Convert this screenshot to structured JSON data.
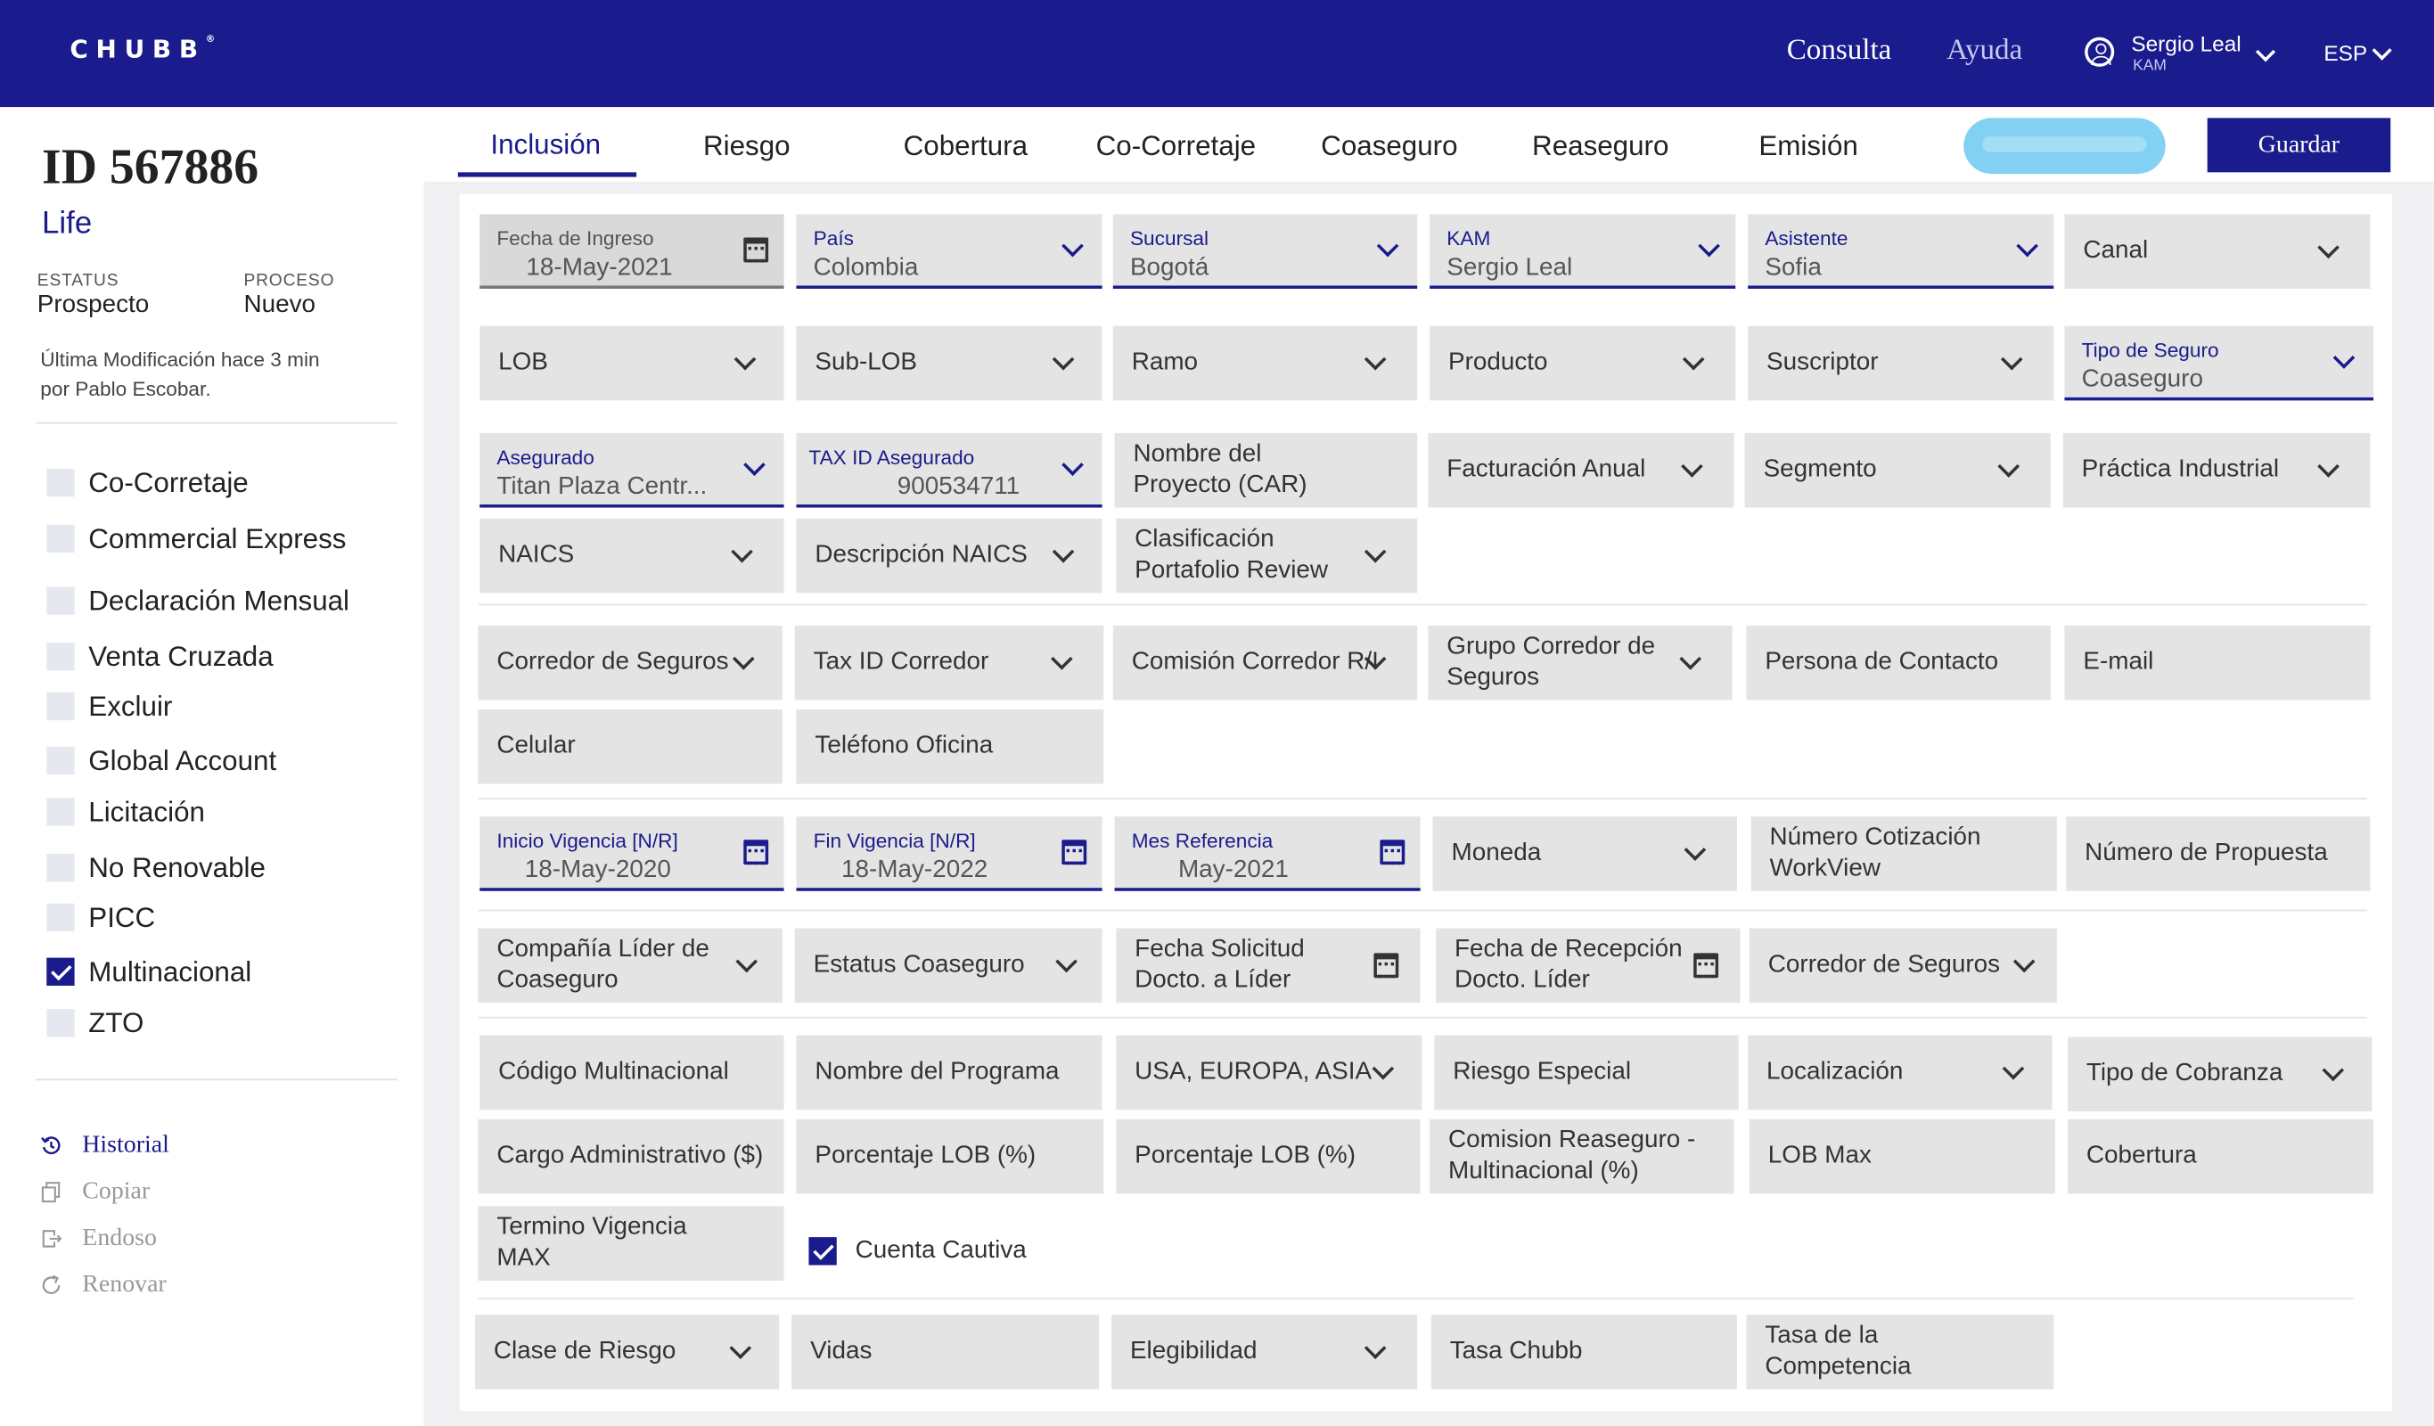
{
  "header": {
    "logo": "CHUBB",
    "nav": [
      "Consulta",
      "Ayuda"
    ],
    "user": {
      "name": "Sergio Leal",
      "role": "KAM"
    },
    "language": "ESP"
  },
  "sidebar": {
    "id": "ID 567886",
    "product": "Life",
    "status_label": "ESTATUS",
    "status": "Prospecto",
    "process_label": "PROCESO",
    "process": "Nuevo",
    "last_modified_line1": "Última Modificación hace 3 min",
    "last_modified_line2": "por Pablo Escobar.",
    "checkboxes": [
      {
        "label": "Co-Corretaje",
        "checked": false
      },
      {
        "label": "Commercial Express",
        "checked": false
      },
      {
        "label": "Declaración Mensual",
        "checked": false
      },
      {
        "label": "Venta Cruzada",
        "checked": false
      },
      {
        "label": "Excluir",
        "checked": false
      },
      {
        "label": "Global Account",
        "checked": false
      },
      {
        "label": "Licitación",
        "checked": false
      },
      {
        "label": "No Renovable",
        "checked": false
      },
      {
        "label": "PICC",
        "checked": false
      },
      {
        "label": "Multinacional",
        "checked": true
      },
      {
        "label": "ZTO",
        "checked": false
      }
    ],
    "actions": [
      {
        "label": "Historial",
        "icon": "history-icon",
        "active": true
      },
      {
        "label": "Copiar",
        "icon": "copy-icon",
        "active": false
      },
      {
        "label": "Endoso",
        "icon": "endorse-icon",
        "active": false
      },
      {
        "label": "Renovar",
        "icon": "renew-icon",
        "active": false
      }
    ]
  },
  "tabs": [
    "Inclusión",
    "Riesgo",
    "Cobertura",
    "Co-Corretaje",
    "Coaseguro",
    "Reaseguro",
    "Emisión"
  ],
  "active_tab": "Inclusión",
  "save_label": "Guardar",
  "form": {
    "fecha_ingreso": {
      "label": "Fecha de Ingreso",
      "value": "18-May-2021"
    },
    "pais": {
      "label": "País",
      "value": "Colombia"
    },
    "sucursal": {
      "label": "Sucursal",
      "value": "Bogotá"
    },
    "kam": {
      "label": "KAM",
      "value": "Sergio Leal"
    },
    "asistente": {
      "label": "Asistente",
      "value": "Sofia"
    },
    "canal": "Canal",
    "lob": "LOB",
    "sub_lob": "Sub-LOB",
    "ramo": "Ramo",
    "producto": "Producto",
    "suscriptor": "Suscriptor",
    "tipo_seguro": {
      "label": "Tipo de Seguro",
      "value": "Coaseguro"
    },
    "asegurado": {
      "label": "Asegurado",
      "value": "Titan Plaza Centr..."
    },
    "tax_id_asegurado": {
      "label": "TAX ID Asegurado",
      "value": "900534711"
    },
    "nombre_proyecto": "Nombre del Proyecto (CAR)",
    "facturacion_anual": "Facturación Anual",
    "segmento": "Segmento",
    "practica_industrial": "Práctica Industrial",
    "naics": "NAICS",
    "descripcion_naics": "Descripción NAICS",
    "clasificacion_portafolio": "Clasificación Portafolio Review",
    "corredor_seguros": "Corredor de Seguros",
    "tax_id_corredor": "Tax ID Corredor",
    "comision_corredor": "Comisión Corredor R/I",
    "grupo_corredor": "Grupo Corredor de Seguros",
    "persona_contacto": "Persona de Contacto",
    "email": "E-mail",
    "celular": "Celular",
    "telefono_oficina": "Teléfono Oficina",
    "inicio_vigencia": {
      "label": "Inicio Vigencia [N/R]",
      "value": "18-May-2020"
    },
    "fin_vigencia": {
      "label": "Fin Vigencia [N/R]",
      "value": "18-May-2022"
    },
    "mes_referencia": {
      "label": "Mes Referencia",
      "value": "May-2021"
    },
    "moneda": "Moneda",
    "numero_cotizacion": "Número Cotización WorkView",
    "numero_propuesta": "Número de Propuesta",
    "compania_lider": "Compañía Líder de Coaseguro",
    "estatus_coaseguro": "Estatus Coaseguro",
    "fecha_solicitud": "Fecha Solicitud Docto. a Líder",
    "fecha_recepcion": "Fecha de Recepción Docto. Líder",
    "corredor_seguros_2": "Corredor de Seguros",
    "codigo_multinacional": "Código Multinacional",
    "nombre_programa": "Nombre del Programa",
    "regiones": "USA, EUROPA, ASIA",
    "riesgo_especial": "Riesgo Especial",
    "localizacion": "Localización",
    "tipo_cobranza": "Tipo de Cobranza",
    "cargo_administrativo": "Cargo Administrativo ($)",
    "porcentaje_lob_1": "Porcentaje LOB (%)",
    "porcentaje_lob_2": "Porcentaje LOB (%)",
    "comision_reaseguro": "Comision Reaseguro - Multinacional (%)",
    "lob_max": "LOB Max",
    "cobertura": "Cobertura",
    "termino_vigencia": "Termino Vigencia MAX",
    "cuenta_cautiva": {
      "label": "Cuenta Cautiva",
      "checked": true
    },
    "clase_riesgo": "Clase de Riesgo",
    "vidas": "Vidas",
    "elegibilidad": "Elegibilidad",
    "tasa_chubb": "Tasa Chubb",
    "tasa_competencia": "Tasa de la Competencia"
  },
  "colors": {
    "primary": "#1a1b8c",
    "field_bg": "#e4e4e4",
    "annotation": "#7ccff2"
  }
}
